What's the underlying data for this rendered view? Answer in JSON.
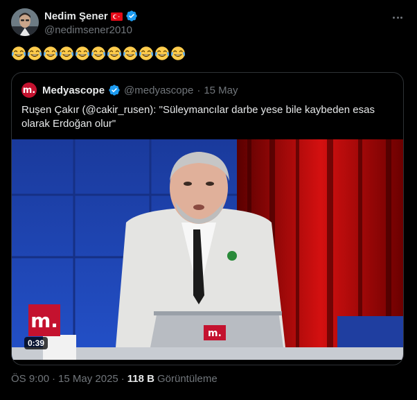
{
  "tweet": {
    "display_name": "Nedim Şener",
    "handle": "@nedimsener2010",
    "emoji_text": "😂😂😂😂😂😂😂😂😂😂😂",
    "emoji_count": 11,
    "time": "ÖS 9:00",
    "dot": "·",
    "date": "15 May 2025",
    "views_separator": "·",
    "views_count": "118 B",
    "views_label": "Görüntüleme"
  },
  "quote": {
    "avatar_letter": "m.",
    "display_name": "Medyascope",
    "handle": "@medyascope",
    "dot": "·",
    "date": "15 May",
    "text": "Ruşen Çakır (@cakir_rusen): \"Süleymancılar darbe yese bile kaybeden esas olarak Erdoğan olur\"",
    "video": {
      "duration": "0:39",
      "logo_text": "m.",
      "laptop_logo_text": "m."
    }
  },
  "colors": {
    "background": "#000000",
    "text_primary": "#e7e9ea",
    "text_secondary": "#71767b",
    "border": "#2f3336",
    "verified": "#1d9bf0",
    "brand_red": "#c4122f"
  }
}
